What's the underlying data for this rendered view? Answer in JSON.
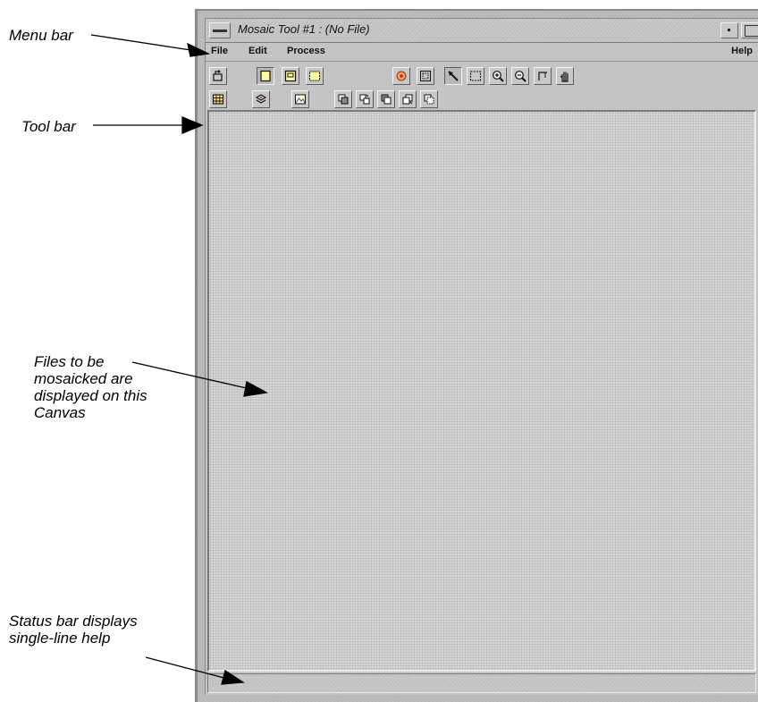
{
  "annotations": {
    "menu_bar": "Menu bar",
    "tool_bar": "Tool bar",
    "canvas_line1": "Files to be",
    "canvas_line2": "mosaicked are",
    "canvas_line3": "displayed on this",
    "canvas_line4": "Canvas",
    "status_line1": "Status bar displays",
    "status_line2": "single-line help"
  },
  "window": {
    "title": "Mosaic Tool #1 : (No File)"
  },
  "menu": {
    "file": "File",
    "edit": "Edit",
    "process": "Process",
    "help": "Help"
  },
  "toolbar": {
    "row1": [
      "open-icon",
      "select-mode-icon",
      "overlay-mode-icon",
      "box-mode-icon",
      "color-correction-icon",
      "image-matching-icon",
      "pointer-icon",
      "select-area-icon",
      "zoom-in-icon",
      "zoom-out-icon",
      "crop-icon",
      "pan-hand-icon"
    ],
    "row2": [
      "table-icon",
      "layers-icon",
      "image-icon",
      "send-to-back-icon",
      "send-backward-icon",
      "bring-forward-icon",
      "bring-to-front-icon",
      "reverse-order-icon"
    ]
  },
  "statusbar": {
    "text": ""
  },
  "colors": {
    "window_bg": "#c4c4c4",
    "canvas_bg": "#d6d6d6",
    "highlight": "#ffffc0",
    "accent_red": "#cc2222",
    "accent_blue": "#2255cc"
  }
}
